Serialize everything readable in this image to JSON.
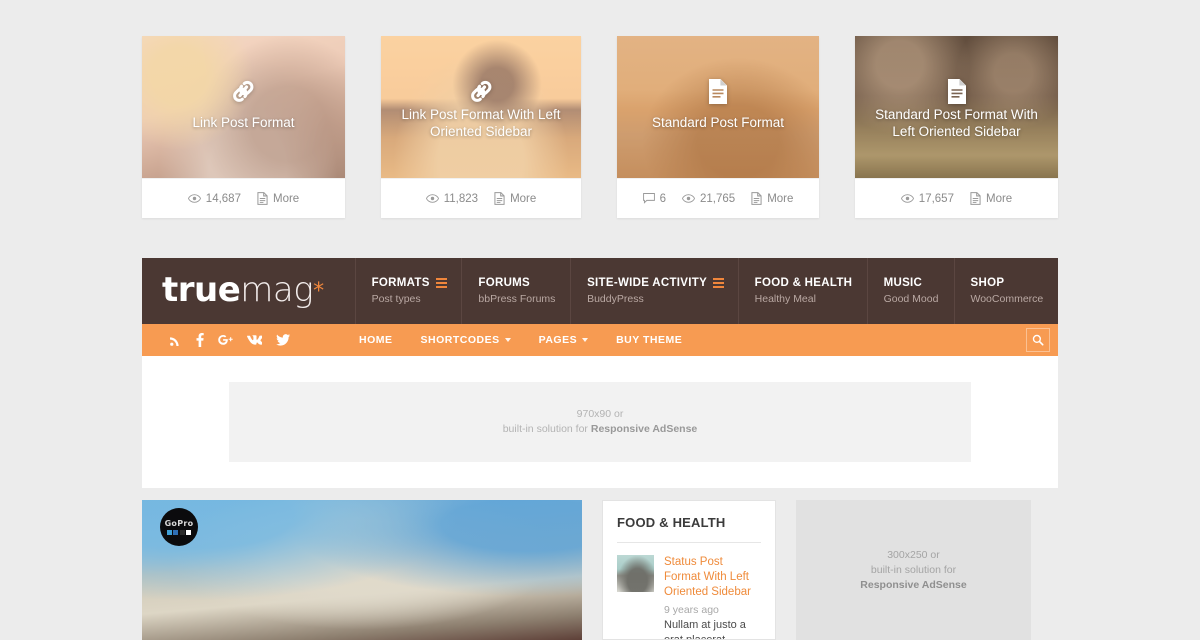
{
  "theme": {
    "bg": "#ececec",
    "brand_brown": "#4b3833",
    "brand_orange": "#f79b52",
    "accent_orange": "#ef8b3b"
  },
  "top_cards": [
    {
      "title": "Link Post Format",
      "format_icon": "link-icon",
      "views": "14,687",
      "comments": null,
      "more_label": "More",
      "tint": "rgba(244,205,178,0.55)"
    },
    {
      "title": "Link Post Format With Left Oriented Sidebar",
      "format_icon": "link-icon",
      "views": "11,823",
      "comments": null,
      "more_label": "More",
      "tint": "rgba(250,198,150,0.45)"
    },
    {
      "title": "Standard Post Format",
      "format_icon": "document-icon",
      "views": "21,765",
      "comments": "6",
      "more_label": "More",
      "tint": "rgba(214,150,94,0.40)"
    },
    {
      "title": "Standard Post Format With Left Oriented Sidebar",
      "format_icon": "document-icon",
      "views": "17,657",
      "comments": null,
      "more_label": "More",
      "tint": "rgba(120,92,70,0.35)"
    }
  ],
  "header": {
    "logo": {
      "bold_part": "true",
      "light_part": "mag",
      "star": "*"
    },
    "nav": [
      {
        "label": "FORMATS",
        "sub": "Post types",
        "has_mega_icon": true
      },
      {
        "label": "FORUMS",
        "sub": "bbPress Forums",
        "has_mega_icon": false
      },
      {
        "label": "SITE-WIDE ACTIVITY",
        "sub": "BuddyPress",
        "has_mega_icon": true
      },
      {
        "label": "FOOD & HEALTH",
        "sub": "Healthy Meal",
        "has_mega_icon": false
      },
      {
        "label": "MUSIC",
        "sub": "Good Mood",
        "has_mega_icon": false
      },
      {
        "label": "SHOP",
        "sub": "WooCommerce",
        "has_mega_icon": false
      }
    ]
  },
  "orange_bar": {
    "socials": [
      "rss-icon",
      "facebook-icon",
      "googleplus-icon",
      "vk-icon",
      "twitter-icon"
    ],
    "menu": [
      {
        "label": "HOME",
        "has_caret": false
      },
      {
        "label": "SHORTCODES",
        "has_caret": true
      },
      {
        "label": "PAGES",
        "has_caret": true
      },
      {
        "label": "BUY THEME",
        "has_caret": false
      }
    ],
    "search_icon": "search-icon"
  },
  "leaderboard_ad": {
    "line1": "970x90 or",
    "line2_prefix": "built-in solution for ",
    "line2_strong": "Responsive AdSense"
  },
  "lower": {
    "featured_post": {
      "badge_text": "GoPro",
      "badge_colors": [
        "#3f9fd6",
        "#2f6fb5",
        "#2b2b2b",
        "#ffffff"
      ]
    },
    "widget": {
      "title": "FOOD & HEALTH",
      "post": {
        "title": "Status Post Format With Left Oriented Sidebar",
        "date": "9 years ago",
        "excerpt": "Nullam at justo a erat placerat"
      }
    },
    "sidebar_ad": {
      "line1": "300x250 or",
      "line2": "built-in solution for",
      "line3_strong": "Responsive AdSense"
    }
  }
}
